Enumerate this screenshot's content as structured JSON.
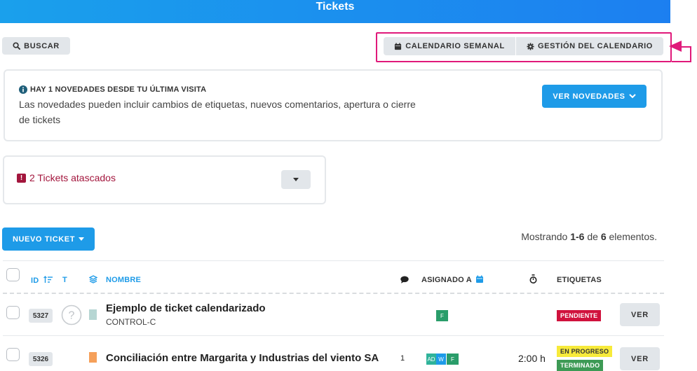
{
  "header": {
    "title": "Tickets"
  },
  "toolbar": {
    "search_label": "BUSCAR",
    "calendar_week_label": "CALENDARIO SEMANAL",
    "calendar_manage_label": "GESTIÓN DEL CALENDARIO"
  },
  "news": {
    "title": "HAY 1 NOVEDADES DESDE TU ÚLTIMA VISITA",
    "text": "Las novedades pueden incluir cambios de etiquetas, nuevos comentarios, apertura o cierre de tickets",
    "button_label": "VER NOVEDADES"
  },
  "stuck": {
    "label": "2 Tickets atascados"
  },
  "new_ticket": {
    "label": "NUEVO TICKET"
  },
  "pagination": {
    "prefix": "Mostrando ",
    "range": "1-6",
    "middle": " de ",
    "total": "6",
    "suffix": " elementos."
  },
  "table": {
    "headers": {
      "id": "ID",
      "type": "T",
      "name": "NOMBRE",
      "assigned": "ASIGNADO A",
      "tags": "ETIQUETAS"
    },
    "rows": [
      {
        "id": "5327",
        "title": "Ejemplo de ticket calendarizado",
        "subtitle": "CONTROL-C",
        "type_icon": "question-circle-icon",
        "color": "#b6d6d3",
        "comments": "",
        "assignees": [
          "F"
        ],
        "time": "",
        "tags": [
          "PENDIENTE"
        ],
        "action_label": "VER"
      },
      {
        "id": "5326",
        "title": "Conciliación entre Margarita y Industrias del viento SA",
        "subtitle": "",
        "type_icon": "",
        "color": "#f5a05a",
        "comments": "1",
        "assignees": [
          "AD",
          "W",
          "F"
        ],
        "time": "2:00 h",
        "tags": [
          "EN PROGRESO",
          "TERMINADO"
        ],
        "action_label": "VER"
      }
    ]
  },
  "colors": {
    "accent": "#1e9be8",
    "highlight": "#e0197a",
    "danger": "#a3163d",
    "tag_pending": "#d0123d",
    "tag_progress": "#f7ea3a",
    "tag_done": "#3d9a55"
  }
}
